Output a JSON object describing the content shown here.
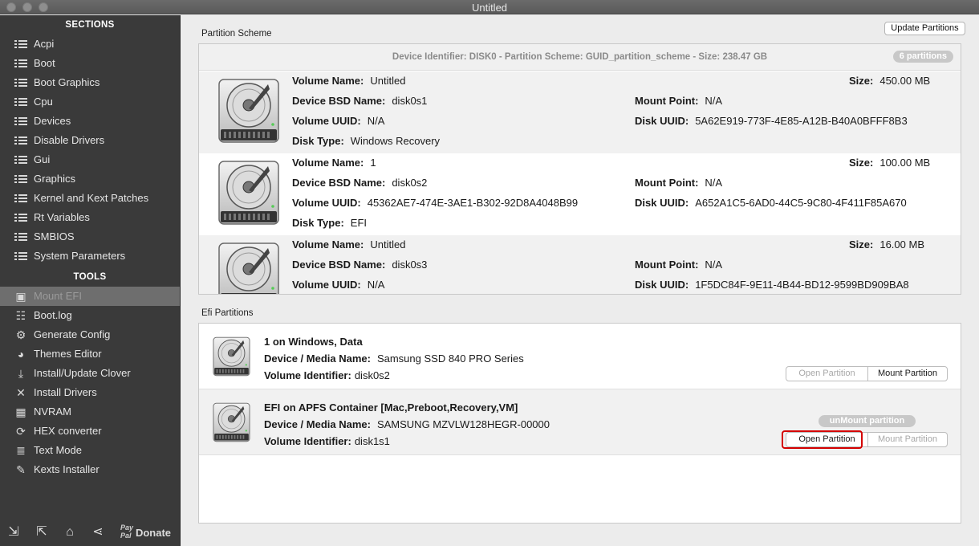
{
  "window": {
    "title": "Untitled"
  },
  "sidebar": {
    "sections_header": "SECTIONS",
    "sections": [
      {
        "label": "Acpi",
        "name": "sidebar-item-acpi"
      },
      {
        "label": "Boot",
        "name": "sidebar-item-boot"
      },
      {
        "label": "Boot Graphics",
        "name": "sidebar-item-boot-graphics"
      },
      {
        "label": "Cpu",
        "name": "sidebar-item-cpu"
      },
      {
        "label": "Devices",
        "name": "sidebar-item-devices"
      },
      {
        "label": "Disable Drivers",
        "name": "sidebar-item-disable-drivers"
      },
      {
        "label": "Gui",
        "name": "sidebar-item-gui"
      },
      {
        "label": "Graphics",
        "name": "sidebar-item-graphics"
      },
      {
        "label": "Kernel and Kext Patches",
        "name": "sidebar-item-kernel-kext-patches"
      },
      {
        "label": "Rt Variables",
        "name": "sidebar-item-rt-variables"
      },
      {
        "label": "SMBIOS",
        "name": "sidebar-item-smbios"
      },
      {
        "label": "System Parameters",
        "name": "sidebar-item-system-parameters"
      }
    ],
    "tools_header": "TOOLS",
    "tools": [
      {
        "label": "Mount EFI",
        "icon": "mount-efi-icon",
        "glyph": "▣"
      },
      {
        "label": "Boot.log",
        "icon": "boot-log-icon",
        "glyph": "☷"
      },
      {
        "label": "Generate Config",
        "icon": "gears-icon",
        "glyph": "⚙"
      },
      {
        "label": "Themes Editor",
        "icon": "palette-icon",
        "glyph": "◕"
      },
      {
        "label": "Install/Update Clover",
        "icon": "download-icon",
        "glyph": "⤓"
      },
      {
        "label": "Install Drivers",
        "icon": "tools-icon",
        "glyph": "✕"
      },
      {
        "label": "NVRAM",
        "icon": "chip-icon",
        "glyph": "▦"
      },
      {
        "label": "HEX converter",
        "icon": "refresh-icon",
        "glyph": "⟳"
      },
      {
        "label": "Text Mode",
        "icon": "text-lines-icon",
        "glyph": "≣"
      },
      {
        "label": "Kexts Installer",
        "icon": "puzzle-icon",
        "glyph": "✎"
      }
    ],
    "footer": {
      "paypal_line1": "Pay",
      "paypal_line2": "Pal",
      "donate": "Donate"
    }
  },
  "partition_scheme": {
    "label": "Partition Scheme",
    "update_button": "Update Partitions",
    "header": "Device Identifier: DISK0 - Partition Scheme: GUID_partition_scheme - Size: 238.47 GB",
    "count_badge": "6 partitions",
    "labels": {
      "volume_name": "Volume Name:",
      "device_bsd": "Device BSD Name:",
      "volume_uuid": "Volume UUID:",
      "disk_type": "Disk Type:",
      "size": "Size:",
      "mount_point": "Mount Point:",
      "disk_uuid": "Disk UUID:"
    },
    "partitions": [
      {
        "volume_name": "Untitled",
        "bsd": "disk0s1",
        "volume_uuid": "N/A",
        "disk_type": "Windows Recovery",
        "size": "450.00 MB",
        "mount_point": "N/A",
        "disk_uuid": "5A62E919-773F-4E85-A12B-B40A0BFFF8B3"
      },
      {
        "volume_name": "1",
        "bsd": "disk0s2",
        "volume_uuid": "45362AE7-474E-3AE1-B302-92D8A4048B99",
        "disk_type": "EFI",
        "size": "100.00 MB",
        "mount_point": "N/A",
        "disk_uuid": "A652A1C5-6AD0-44C5-9C80-4F411F85A670"
      },
      {
        "volume_name": "Untitled",
        "bsd": "disk0s3",
        "volume_uuid": "N/A",
        "disk_type": "",
        "size": "16.00 MB",
        "mount_point": "N/A",
        "disk_uuid": "1F5DC84F-9E11-4B44-BD12-9599BD909BA8"
      }
    ]
  },
  "efi_partitions": {
    "label": "Efi Partitions",
    "labels": {
      "device_media": "Device / Media Name:",
      "volume_identifier": "Volume Identifier:"
    },
    "open_button": "Open Partition",
    "mount_button": "Mount Partition",
    "unmount_badge": "unMount partition",
    "items": [
      {
        "title": "1 on Windows, Data",
        "device_media": "Samsung SSD 840 PRO Series",
        "volume_identifier": "disk0s2"
      },
      {
        "title": "EFI on APFS Container [Mac,Preboot,Recovery,VM]",
        "device_media": "SAMSUNG MZVLW128HEGR-00000",
        "volume_identifier": "disk1s1"
      }
    ]
  },
  "colors": {
    "sidebar_bg": "#3a3a3a",
    "highlight_red": "#d40000",
    "badge_gray": "#c8c8c8"
  }
}
